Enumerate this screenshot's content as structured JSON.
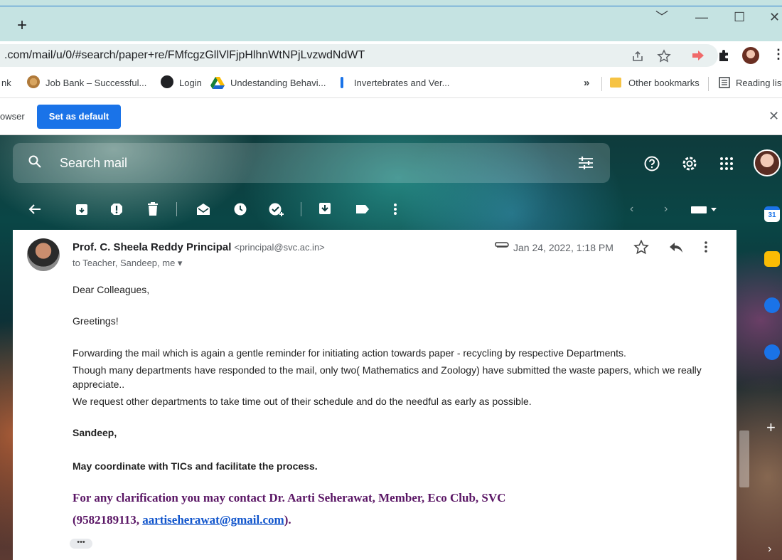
{
  "browser": {
    "new_tab": "+",
    "window_controls": {
      "dropdown": "﹀",
      "minimize": "—",
      "maximize": "☐",
      "close": "✕"
    },
    "url": ".com/mail/u/0/#search/paper+re/FMfcgzGllVlFjpHlhnWtNPjLvzwdNdWT",
    "bookmarks": [
      {
        "label": "nk"
      },
      {
        "label": "Job Bank – Successful..."
      },
      {
        "label": "Login"
      },
      {
        "label": "Undestanding Behavi..."
      },
      {
        "label": "Invertebrates and Ver..."
      }
    ],
    "bookmark_more": "»",
    "other_bookmarks": "Other bookmarks",
    "reading_list": "Reading list",
    "infobar_text": "owser",
    "set_default_label": "Set as default",
    "infobar_close": "✕"
  },
  "gmail": {
    "search_placeholder": "Search mail",
    "message": {
      "sender_name": "Prof. C. Sheela Reddy Principal",
      "sender_email": "<principal@svc.ac.in>",
      "recipients": "to Teacher, Sandeep, me ▾",
      "date": "Jan 24, 2022, 1:18 PM",
      "body": {
        "greeting": "Dear Colleagues,",
        "greetings2": "Greetings!",
        "p1": "Forwarding the mail which is again a gentle reminder for initiating action towards paper - recycling by respective Departments.",
        "p2": "Though many departments have responded to the mail, only two( Mathematics and Zoology) have submitted the waste papers, which we really appreciate..",
        "p3": "We request other departments to take time out of their schedule and do the needful as early as possible.",
        "addressee": "Sandeep,",
        "instruction": "May coordinate with TICs and facilitate the process.",
        "contact_line1": "For any clarification you may contact Dr. Aarti Seherawat, Member, Eco Club, SVC",
        "contact_prefix": "(9582189113, ",
        "contact_email": "aartiseherawat@gmail.com",
        "contact_suffix": ")."
      },
      "ellipsis": "•••"
    }
  },
  "colors": {
    "accent": "#1a73e8",
    "link": "#1155cc",
    "contact_purple": "#5a1665"
  }
}
